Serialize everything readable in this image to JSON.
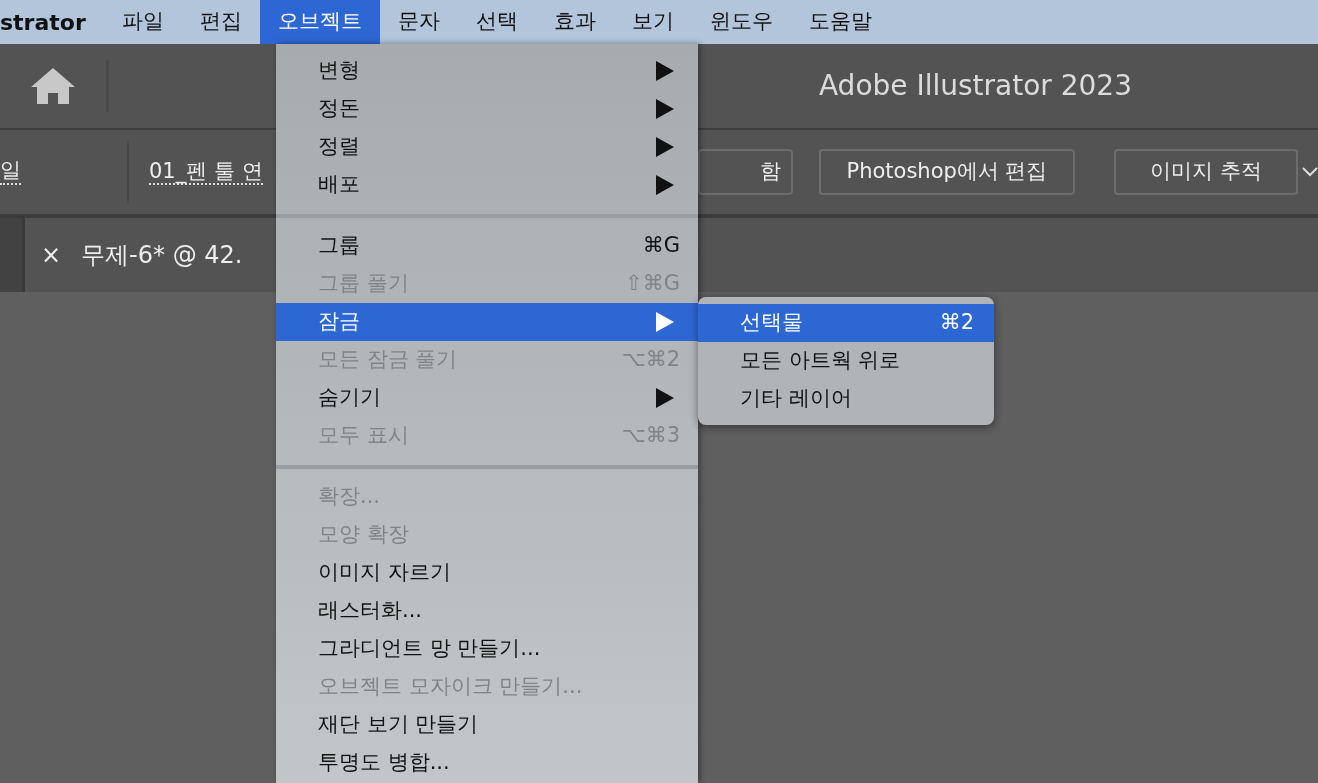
{
  "menubar": {
    "app_name": "strator",
    "items": [
      {
        "label": "파일",
        "selected": false
      },
      {
        "label": "편집",
        "selected": false
      },
      {
        "label": "오브젝트",
        "selected": true
      },
      {
        "label": "문자",
        "selected": false
      },
      {
        "label": "선택",
        "selected": false
      },
      {
        "label": "효과",
        "selected": false
      },
      {
        "label": "보기",
        "selected": false
      },
      {
        "label": "윈도우",
        "selected": false
      },
      {
        "label": "도움말",
        "selected": false
      }
    ]
  },
  "title_bar": {
    "title": "Adobe Illustrator 2023"
  },
  "control_bar": {
    "links": [
      "일",
      "01_펜 툴 연"
    ],
    "buttons": [
      "함",
      "Photoshop에서 편집",
      "이미지 추적"
    ]
  },
  "document_tab": {
    "close": "×",
    "title": "무제-6* @ 42."
  },
  "dropdown": {
    "items": [
      {
        "kind": "item",
        "label": "변형",
        "submenu": true,
        "disabled": false,
        "selected": false
      },
      {
        "kind": "item",
        "label": "정돈",
        "submenu": true,
        "disabled": false,
        "selected": false
      },
      {
        "kind": "item",
        "label": "정렬",
        "submenu": true,
        "disabled": false,
        "selected": false
      },
      {
        "kind": "item",
        "label": "배포",
        "submenu": true,
        "disabled": false,
        "selected": false
      },
      {
        "kind": "separator"
      },
      {
        "kind": "item",
        "label": "그룹",
        "shortcut": "⌘G",
        "disabled": false,
        "selected": false
      },
      {
        "kind": "item",
        "label": "그룹 풀기",
        "shortcut": "⇧⌘G",
        "disabled": true,
        "selected": false
      },
      {
        "kind": "item",
        "label": "잠금",
        "submenu": true,
        "disabled": false,
        "selected": true
      },
      {
        "kind": "item",
        "label": "모든 잠금 풀기",
        "shortcut": "⌥⌘2",
        "disabled": true,
        "selected": false
      },
      {
        "kind": "item",
        "label": "숨기기",
        "submenu": true,
        "disabled": false,
        "selected": false
      },
      {
        "kind": "item",
        "label": "모두 표시",
        "shortcut": "⌥⌘3",
        "disabled": true,
        "selected": false
      },
      {
        "kind": "separator"
      },
      {
        "kind": "item",
        "label": "확장...",
        "disabled": true,
        "selected": false
      },
      {
        "kind": "item",
        "label": "모양 확장",
        "disabled": true,
        "selected": false
      },
      {
        "kind": "item",
        "label": "이미지 자르기",
        "disabled": false,
        "selected": false
      },
      {
        "kind": "item",
        "label": "래스터화...",
        "disabled": false,
        "selected": false
      },
      {
        "kind": "item",
        "label": "그라디언트 망 만들기...",
        "disabled": false,
        "selected": false
      },
      {
        "kind": "item",
        "label": "오브젝트 모자이크 만들기...",
        "disabled": true,
        "selected": false
      },
      {
        "kind": "item",
        "label": "재단 보기 만들기",
        "disabled": false,
        "selected": false
      },
      {
        "kind": "item",
        "label": "투명도 병합...",
        "disabled": false,
        "selected": false
      }
    ]
  },
  "submenu": {
    "items": [
      {
        "label": "선택물",
        "shortcut": "⌘2",
        "selected": true
      },
      {
        "label": "모든 아트웍 위로",
        "selected": false
      },
      {
        "label": "기타 레이어",
        "selected": false
      }
    ]
  }
}
